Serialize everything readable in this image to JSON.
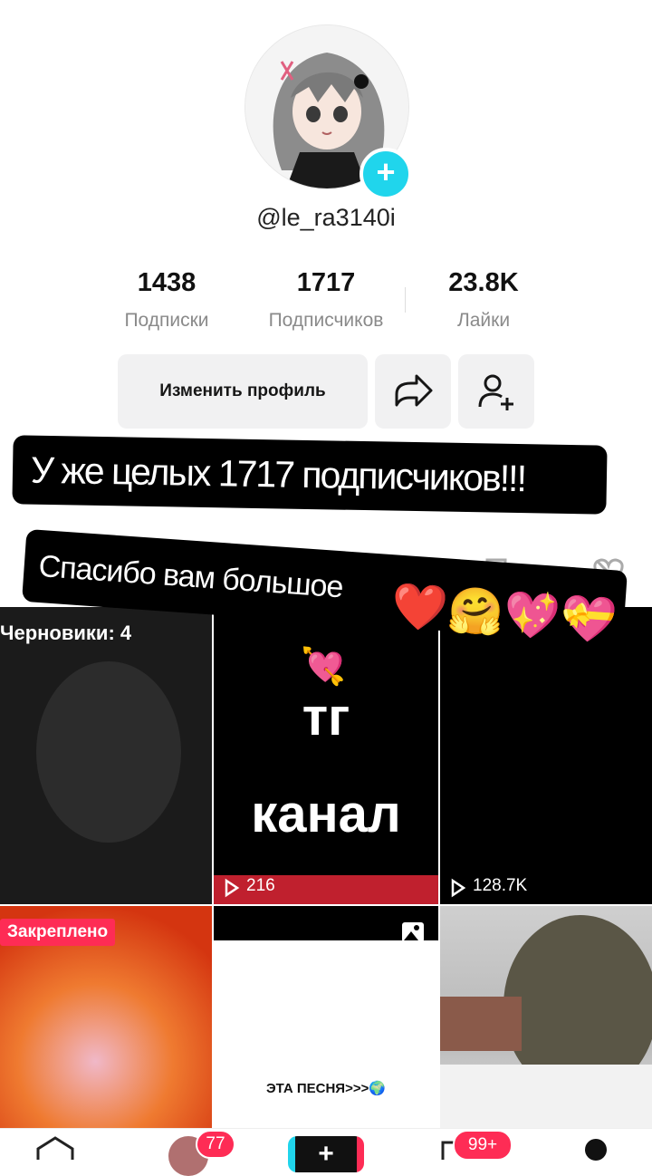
{
  "profile": {
    "username": "@le_ra3140i",
    "stats": [
      {
        "value": "1438",
        "label": "Подписки"
      },
      {
        "value": "1717",
        "label": "Подписчиков"
      },
      {
        "value": "23.8K",
        "label": "Лайки"
      }
    ],
    "edit_button": "Изменить профиль"
  },
  "stickers": {
    "main": "У же целых 1717 подписчиков!!!",
    "thanks": "Спасибо вам большое",
    "thanks_emoji": "❤️🤗💖💝",
    "arrow_heart": "💘"
  },
  "grid": {
    "drafts_label": "Черновики: 4",
    "cells": [
      {
        "views": "216",
        "text_line1": "тг",
        "text_line2": "канал"
      },
      {
        "views": "128.7K"
      },
      {
        "pinned": "Закреплено"
      },
      {
        "caption": "ЭТА ПЕСНЯ>>>🌍"
      }
    ]
  },
  "nav": {
    "inbox_badge": "77",
    "messages_badge": "99+"
  },
  "colors": {
    "accent_cyan": "#20d5ec",
    "badge_red": "#fe2c55"
  }
}
